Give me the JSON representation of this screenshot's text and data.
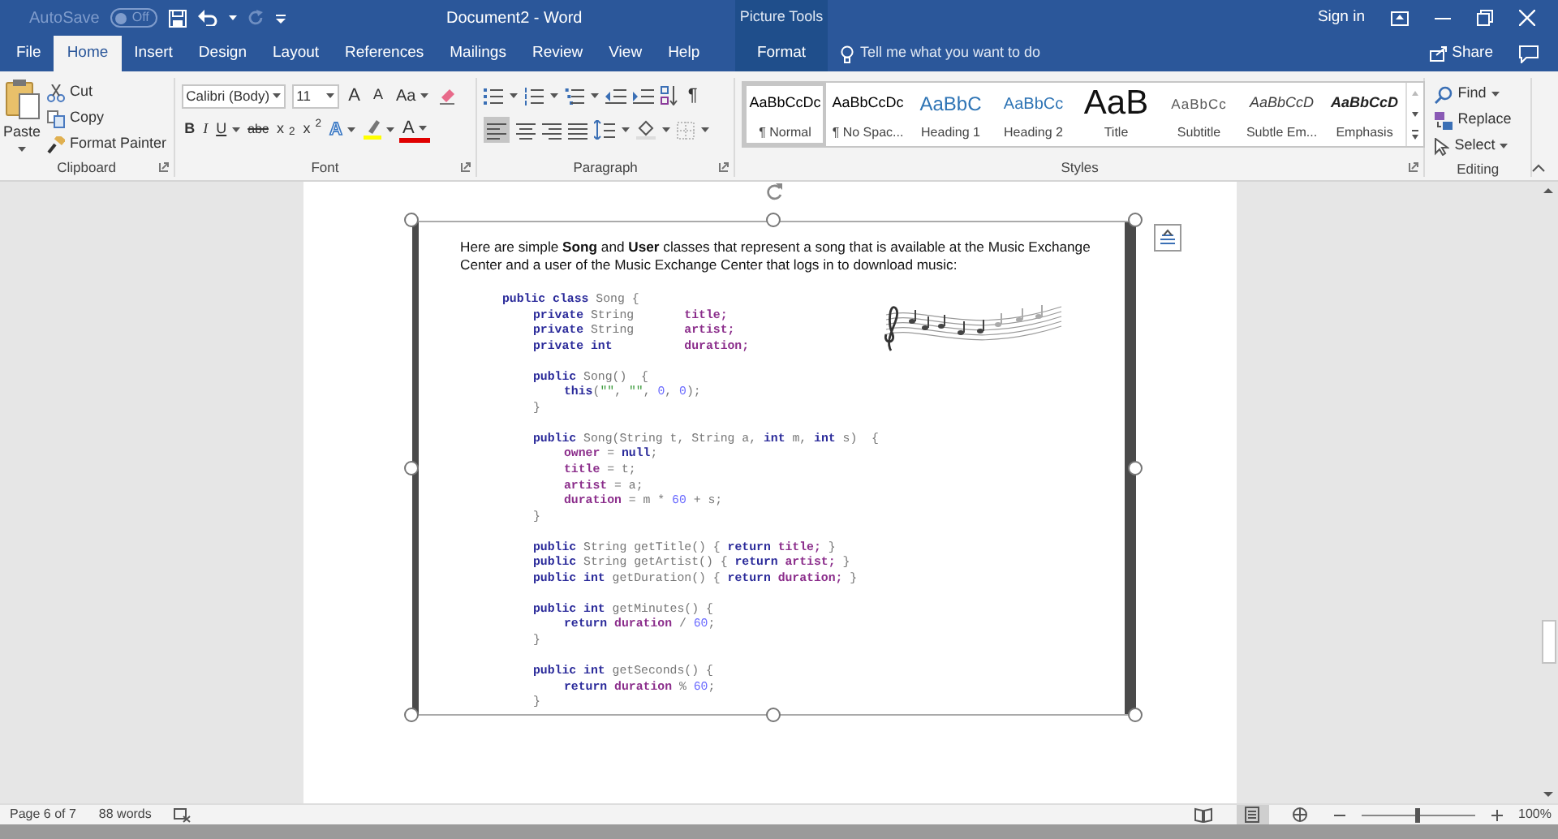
{
  "title_bar": {
    "autosave_label": "AutoSave",
    "autosave_state": "Off",
    "autosave_on": false,
    "document_title": "Document2  -  Word",
    "context_label": "Picture Tools",
    "sign_in": "Sign in"
  },
  "tabs": [
    {
      "label": "File",
      "selected": false,
      "kind": "normal"
    },
    {
      "label": "Home",
      "selected": true,
      "kind": "normal"
    },
    {
      "label": "Insert",
      "selected": false,
      "kind": "normal"
    },
    {
      "label": "Design",
      "selected": false,
      "kind": "normal"
    },
    {
      "label": "Layout",
      "selected": false,
      "kind": "normal"
    },
    {
      "label": "References",
      "selected": false,
      "kind": "normal"
    },
    {
      "label": "Mailings",
      "selected": false,
      "kind": "normal"
    },
    {
      "label": "Review",
      "selected": false,
      "kind": "normal"
    },
    {
      "label": "View",
      "selected": false,
      "kind": "normal"
    },
    {
      "label": "Help",
      "selected": false,
      "kind": "normal"
    },
    {
      "label": "Format",
      "selected": false,
      "kind": "contextual"
    }
  ],
  "tell_me": {
    "placeholder": "Tell me what you want to do"
  },
  "share": "Share",
  "ribbon": {
    "clipboard": {
      "paste": "Paste",
      "cut": "Cut",
      "copy": "Copy",
      "format_painter": "Format Painter",
      "label": "Clipboard"
    },
    "font": {
      "font_name": "Calibri (Body)",
      "font_size": "11",
      "grow": "A",
      "shrink": "A",
      "change_case": "Aa",
      "bold": "B",
      "italic": "I",
      "underline": "U",
      "strikethrough": "abc",
      "subscript": "x$_{2}$",
      "superscript": "x$^{2}$",
      "text_effects": "A",
      "font_color": "A",
      "label": "Font"
    },
    "paragraph": {
      "show_marks": "¶",
      "align_left_selected": true,
      "label": "Paragraph"
    },
    "styles": {
      "label": "Styles",
      "items": [
        {
          "preview": "AaBbCcDc",
          "name": "¶ Normal",
          "selected": true,
          "kind": "normal"
        },
        {
          "preview": "AaBbCcDc",
          "name": "¶ No Spac...",
          "selected": false,
          "kind": "no_spacing"
        },
        {
          "preview": "AaBbC",
          "name": "Heading 1",
          "selected": false,
          "kind": "heading1"
        },
        {
          "preview": "AaBbCc",
          "name": "Heading 2",
          "selected": false,
          "kind": "heading2"
        },
        {
          "preview": "AaB",
          "name": "Title",
          "selected": false,
          "kind": "title"
        },
        {
          "preview": "AaBbCc",
          "name": "Subtitle",
          "selected": false,
          "kind": "subtitle"
        },
        {
          "preview": "AaBbCcD",
          "name": "Subtle Em...",
          "selected": false,
          "kind": "subtle_emphasis"
        },
        {
          "preview": "AaBbCcD",
          "name": "Emphasis",
          "selected": false,
          "kind": "emphasis"
        }
      ]
    },
    "editing": {
      "find": "Find",
      "replace": "Replace",
      "select": "Select",
      "label": "Editing"
    }
  },
  "document": {
    "intro": "Here are simple **Song** and **User** classes that represent a song that is available at the Music Exchange Center and a user of the Music Exchange Center that logs in to download music:",
    "code": [
      {
        "kind": "class",
        "segments": [
          {
            "text": "public class",
            "kind": "keyword"
          },
          {
            "text": " Song {",
            "kind": "plain"
          }
        ]
      },
      {
        "kind": "member",
        "segments": [
          {
            "text": "private",
            "kind": "keyword"
          },
          {
            "text": " String       ",
            "kind": "plain"
          },
          {
            "text": "title;",
            "kind": "field"
          }
        ]
      },
      {
        "kind": "member",
        "segments": [
          {
            "text": "private",
            "kind": "keyword"
          },
          {
            "text": " String       ",
            "kind": "plain"
          },
          {
            "text": "artist;",
            "kind": "field"
          }
        ]
      },
      {
        "kind": "member",
        "segments": [
          {
            "text": "private int          ",
            "kind": "keyword"
          },
          {
            "text": "duration;",
            "kind": "field"
          }
        ]
      },
      {
        "kind": "member",
        "gap_before": true,
        "segments": [
          {
            "text": "public",
            "kind": "keyword"
          },
          {
            "text": " Song()  {",
            "kind": "plain"
          }
        ]
      },
      {
        "kind": "body",
        "segments": [
          {
            "text": "this",
            "kind": "keyword"
          },
          {
            "text": "(",
            "kind": "plain"
          },
          {
            "text": "\"\"",
            "kind": "string"
          },
          {
            "text": ", ",
            "kind": "plain"
          },
          {
            "text": "\"\"",
            "kind": "string"
          },
          {
            "text": ", ",
            "kind": "plain"
          },
          {
            "text": "0",
            "kind": "number"
          },
          {
            "text": ", ",
            "kind": "plain"
          },
          {
            "text": "0",
            "kind": "number"
          },
          {
            "text": ");",
            "kind": "plain"
          }
        ]
      },
      {
        "kind": "member",
        "segments": [
          {
            "text": "}",
            "kind": "plain"
          }
        ]
      },
      {
        "kind": "member",
        "gap_before": true,
        "segments": [
          {
            "text": "public",
            "kind": "keyword"
          },
          {
            "text": " Song(String t, String a, ",
            "kind": "plain"
          },
          {
            "text": "int",
            "kind": "keyword"
          },
          {
            "text": " m, ",
            "kind": "plain"
          },
          {
            "text": "int",
            "kind": "keyword"
          },
          {
            "text": " s)  {",
            "kind": "plain"
          }
        ]
      },
      {
        "kind": "body",
        "segments": [
          {
            "text": "owner",
            "kind": "field"
          },
          {
            "text": " = ",
            "kind": "plain"
          },
          {
            "text": "null",
            "kind": "keyword"
          },
          {
            "text": ";",
            "kind": "plain"
          }
        ]
      },
      {
        "kind": "body",
        "segments": [
          {
            "text": "title",
            "kind": "field"
          },
          {
            "text": " = t;",
            "kind": "plain"
          }
        ]
      },
      {
        "kind": "body",
        "segments": [
          {
            "text": "artist",
            "kind": "field"
          },
          {
            "text": " = a;",
            "kind": "plain"
          }
        ]
      },
      {
        "kind": "body",
        "segments": [
          {
            "text": "duration",
            "kind": "field"
          },
          {
            "text": " = m * ",
            "kind": "plain"
          },
          {
            "text": "60",
            "kind": "number"
          },
          {
            "text": " + s;",
            "kind": "plain"
          }
        ]
      },
      {
        "kind": "member",
        "segments": [
          {
            "text": "}",
            "kind": "plain"
          }
        ]
      },
      {
        "kind": "member",
        "gap_before": true,
        "segments": [
          {
            "text": "public",
            "kind": "keyword"
          },
          {
            "text": " String getTitle() { ",
            "kind": "plain"
          },
          {
            "text": "return ",
            "kind": "keyword"
          },
          {
            "text": "title;",
            "kind": "field"
          },
          {
            "text": " }",
            "kind": "plain"
          }
        ]
      },
      {
        "kind": "member",
        "segments": [
          {
            "text": "public",
            "kind": "keyword"
          },
          {
            "text": " String getArtist() { ",
            "kind": "plain"
          },
          {
            "text": "return ",
            "kind": "keyword"
          },
          {
            "text": "artist;",
            "kind": "field"
          },
          {
            "text": " }",
            "kind": "plain"
          }
        ]
      },
      {
        "kind": "member",
        "segments": [
          {
            "text": "public int",
            "kind": "keyword"
          },
          {
            "text": " getDuration() { ",
            "kind": "plain"
          },
          {
            "text": "return ",
            "kind": "keyword"
          },
          {
            "text": "duration;",
            "kind": "field"
          },
          {
            "text": " }",
            "kind": "plain"
          }
        ]
      },
      {
        "kind": "member",
        "gap_before": true,
        "segments": [
          {
            "text": "public int",
            "kind": "keyword"
          },
          {
            "text": " getMinutes() {",
            "kind": "plain"
          }
        ]
      },
      {
        "kind": "body",
        "segments": [
          {
            "text": "return ",
            "kind": "keyword"
          },
          {
            "text": "duration",
            "kind": "field"
          },
          {
            "text": " / ",
            "kind": "plain"
          },
          {
            "text": "60",
            "kind": "number"
          },
          {
            "text": ";",
            "kind": "plain"
          }
        ]
      },
      {
        "kind": "member",
        "segments": [
          {
            "text": "}",
            "kind": "plain"
          }
        ]
      },
      {
        "kind": "member",
        "gap_before": true,
        "segments": [
          {
            "text": "public int",
            "kind": "keyword"
          },
          {
            "text": " getSeconds() {",
            "kind": "plain"
          }
        ]
      },
      {
        "kind": "body",
        "segments": [
          {
            "text": "return ",
            "kind": "keyword"
          },
          {
            "text": "duration",
            "kind": "field"
          },
          {
            "text": " % ",
            "kind": "plain"
          },
          {
            "text": "60",
            "kind": "number"
          },
          {
            "text": ";",
            "kind": "plain"
          }
        ]
      },
      {
        "kind": "member",
        "segments": [
          {
            "text": "}",
            "kind": "plain"
          }
        ]
      }
    ]
  },
  "status_bar": {
    "page": "Page 6 of 7",
    "words": "88 words",
    "zoom": "100%",
    "zoom_slider": {
      "level": 0.5
    },
    "views": [
      {
        "kind": "read",
        "selected": false
      },
      {
        "kind": "print",
        "selected": true
      },
      {
        "kind": "web",
        "selected": false
      }
    ]
  }
}
